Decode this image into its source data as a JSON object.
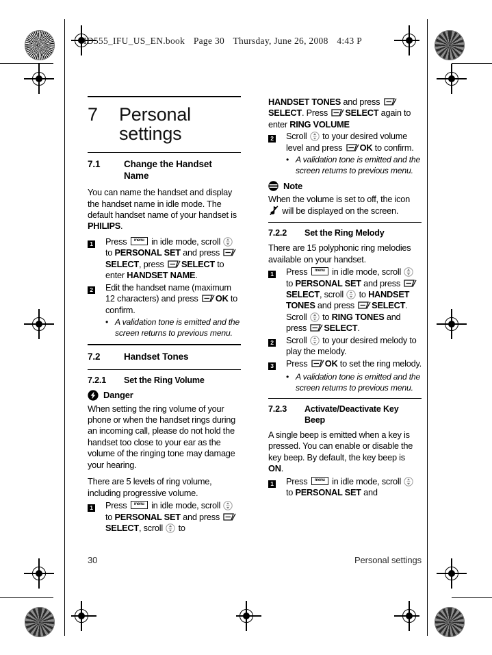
{
  "header": {
    "filename": "ID555_IFU_US_EN.book",
    "page_label": "Page 30",
    "weekday": "Thursday, June 26, 2008",
    "time": "4:43 P"
  },
  "chapter": {
    "number": "7",
    "title": "Personal settings"
  },
  "sections": {
    "s71": {
      "number": "7.1",
      "title_line1": "Change the Handset",
      "title_line2": "Name",
      "intro_a": "You can name the handset and display the handset name in idle mode. The default handset name of your handset is ",
      "intro_b": "PHILIPS",
      "intro_c": ".",
      "step1": {
        "num": "1",
        "t1": "Press ",
        "t2": " in idle mode, scroll ",
        "t3": " to ",
        "t4": "PERSONAL SET",
        "t5": " and press ",
        "t6": "SELECT",
        "t7": ", press ",
        "t8": "SELECT",
        "t9": " to enter ",
        "t10": "HANDSET NAME",
        "t11": "."
      },
      "step2": {
        "num": "2",
        "t1": "Edit the handset name (maximum 12 characters) and press ",
        "t2": "OK",
        "t3": " to confirm."
      },
      "bullet": "A validation tone is emitted and the screen returns to previous menu."
    },
    "s72": {
      "number": "7.2",
      "title": "Handset Tones"
    },
    "s721": {
      "number": "7.2.1",
      "title": "Set the Ring Volume",
      "danger_label": "Danger",
      "danger_text": "When setting the ring volume of your phone or when the handset rings during an incoming call, please do not hold the handset too close to your ear as the volume of the ringing tone may damage your hearing.",
      "levels_text": "There are 5 levels of ring volume, including progressive volume.",
      "step1": {
        "num": "1",
        "t1": "Press ",
        "t2": " in idle mode, scroll ",
        "t3": " to ",
        "t4": "PERSONAL SET",
        "t5": " and press ",
        "t6": "SELECT",
        "t7": ", scroll ",
        "t8": " to ",
        "t9": "HANDSET TONES",
        "t10": " and press ",
        "t11": "SELECT",
        "t12": ". Press ",
        "t13": "SELECT",
        "t14": " again to enter ",
        "t15": "RING VOLUME"
      },
      "step2": {
        "num": "2",
        "t1": "Scroll ",
        "t2": " to your desired volume level and press ",
        "t3": "OK",
        "t4": " to confirm."
      },
      "bullet": "A validation tone is emitted and the screen returns to previous menu.",
      "note_label": "Note",
      "note_t1": "When the volume is set to off, the icon ",
      "note_t2": " will be displayed on the screen."
    },
    "s722": {
      "number": "7.2.2",
      "title": "Set the Ring Melody",
      "intro": "There are 15 polyphonic ring melodies available on your handset.",
      "step1": {
        "num": "1",
        "t1": "Press ",
        "t2": " in idle mode, scroll ",
        "t3": " to ",
        "t4": "PERSONAL SET",
        "t5": " and press ",
        "t6": "SELECT",
        "t7": ", scroll ",
        "t8": " to ",
        "t9": "HANDSET TONES",
        "t10": " and press ",
        "t11": "SELECT",
        "t12": ". Scroll ",
        "t13": " to ",
        "t14": "RING TONES",
        "t15": " and press ",
        "t16": "SELECT",
        "t17": "."
      },
      "step2": {
        "num": "2",
        "t1": "Scroll ",
        "t2": " to your desired melody to play the melody."
      },
      "step3": {
        "num": "3",
        "t1": "Press ",
        "t2": "OK",
        "t3": " to set the ring melody."
      },
      "bullet": "A validation tone is emitted and the screen returns to previous menu."
    },
    "s723": {
      "number": "7.2.3",
      "title_line1": "Activate/Deactivate Key",
      "title_line2": "Beep",
      "intro_a": "A single beep is emitted when a key is pressed. You can enable or disable the key beep. By default, the key beep is ",
      "intro_b": "ON",
      "intro_c": ".",
      "step1": {
        "num": "1",
        "t1": "Press ",
        "t2": " in idle mode, scroll ",
        "t3": " to ",
        "t4": "PERSONAL SET",
        "t5": " and"
      }
    }
  },
  "footer": {
    "page_number": "30",
    "running_title": "Personal settings"
  },
  "icons": {
    "menu_key": "menu",
    "softkey": "softkey-icon",
    "scroll": "scroll-icon",
    "ring_off": "ring-off-icon"
  }
}
